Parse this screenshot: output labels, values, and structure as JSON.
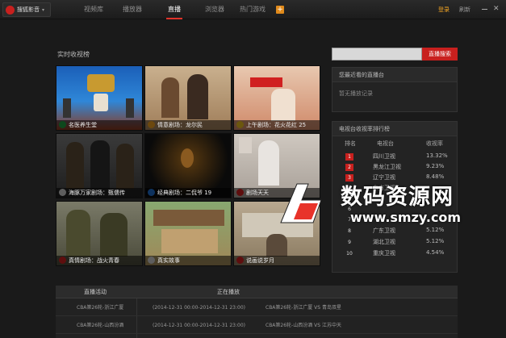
{
  "app": {
    "logo_text": "搜狐影音",
    "logo_caret": "▾"
  },
  "nav": [
    "视频库",
    "播放器",
    "直播",
    "浏览器",
    "热门游戏"
  ],
  "nav_plus": "+",
  "header_actions": {
    "login": "登录",
    "refresh": "刷新",
    "close": "✕"
  },
  "section_title": "实时收视榜",
  "channels": [
    {
      "label": "名医养生堂",
      "badge_color": "#20a040"
    },
    {
      "label": "情意剧场：龙尔民",
      "badge_color": "#f0a020"
    },
    {
      "label": "上午剧场：花火花红 25",
      "badge_color": "#f0c020"
    },
    {
      "label": "海豚万家剧场：甄儒传",
      "badge_color": "#d0d0d0"
    },
    {
      "label": "经典剧场：二侃爷 19",
      "badge_color": "#2070d0"
    },
    {
      "label": "剧场天天",
      "badge_color": "#d02020"
    },
    {
      "label": "真情剧场：战火青春",
      "badge_color": "#d02020"
    },
    {
      "label": "真实故事",
      "badge_color": "#d0d0d0"
    },
    {
      "label": "说画说岁月",
      "badge_color": "#d02020"
    }
  ],
  "search": {
    "placeholder": "",
    "button": "直播搜索"
  },
  "recent": {
    "title": "您最近看的直播台",
    "empty": "暂无播放记录"
  },
  "ranking": {
    "title": "电视台收视率排行榜",
    "headers": {
      "rank": "排名",
      "station": "电视台",
      "rate": "收视率"
    },
    "rows": [
      {
        "rank": "1",
        "station": "四川卫视",
        "rate": "13.32%"
      },
      {
        "rank": "2",
        "station": "黑龙江卫视",
        "rate": "9.23%"
      },
      {
        "rank": "3",
        "station": "辽宁卫视",
        "rate": "8.48%"
      },
      {
        "rank": "4",
        "station": "东方卫视",
        "rate": ""
      },
      {
        "rank": "5",
        "station": "",
        "rate": ""
      },
      {
        "rank": "6",
        "station": "",
        "rate": ""
      },
      {
        "rank": "7",
        "station": "",
        "rate": ""
      },
      {
        "rank": "8",
        "station": "广东卫视",
        "rate": "5.12%"
      },
      {
        "rank": "9",
        "station": "湖北卫视",
        "rate": "5.12%"
      },
      {
        "rank": "10",
        "station": "重庆卫视",
        "rate": "4.54%"
      }
    ]
  },
  "schedule": {
    "headers": {
      "live": "直播活动",
      "playing": "正在播放"
    },
    "rows": [
      {
        "title": "CBA第26轮-浙江广厦",
        "time": "(2014-12-31 00:00-2014-12-31 23:00)",
        "match": "CBA第26轮-浙江广厦 VS 青岛双星"
      },
      {
        "title": "CBA第26轮-山西汾酒",
        "time": "(2014-12-31 00:00-2014-12-31 23:00)",
        "match": "CBA第26轮-山西汾酒 VS 江苏中天"
      }
    ]
  },
  "watermark": {
    "text": "数码资源网",
    "url": "www.smzy.com"
  }
}
